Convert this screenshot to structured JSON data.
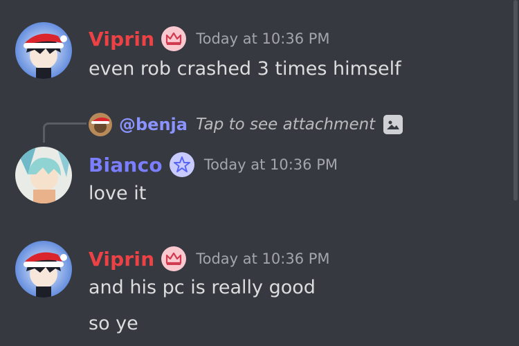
{
  "messages": [
    {
      "author": "Viprin",
      "author_color": "#ed4245",
      "badge_icon": "crown-icon",
      "timestamp": "Today at 10:36 PM",
      "lines": [
        "even rob crashed 3 times himself"
      ]
    },
    {
      "reply": {
        "mention": "@benja",
        "text": "Tap to see attachment",
        "icon": "image-icon"
      },
      "author": "Bianco",
      "author_color": "#7b7fff",
      "badge_icon": "star-icon",
      "timestamp": "Today at 10:36 PM",
      "lines": [
        "love it"
      ]
    },
    {
      "author": "Viprin",
      "author_color": "#ed4245",
      "badge_icon": "crown-icon",
      "timestamp": "Today at 10:36 PM",
      "lines": [
        "and his pc is really good",
        "so ye"
      ]
    }
  ]
}
